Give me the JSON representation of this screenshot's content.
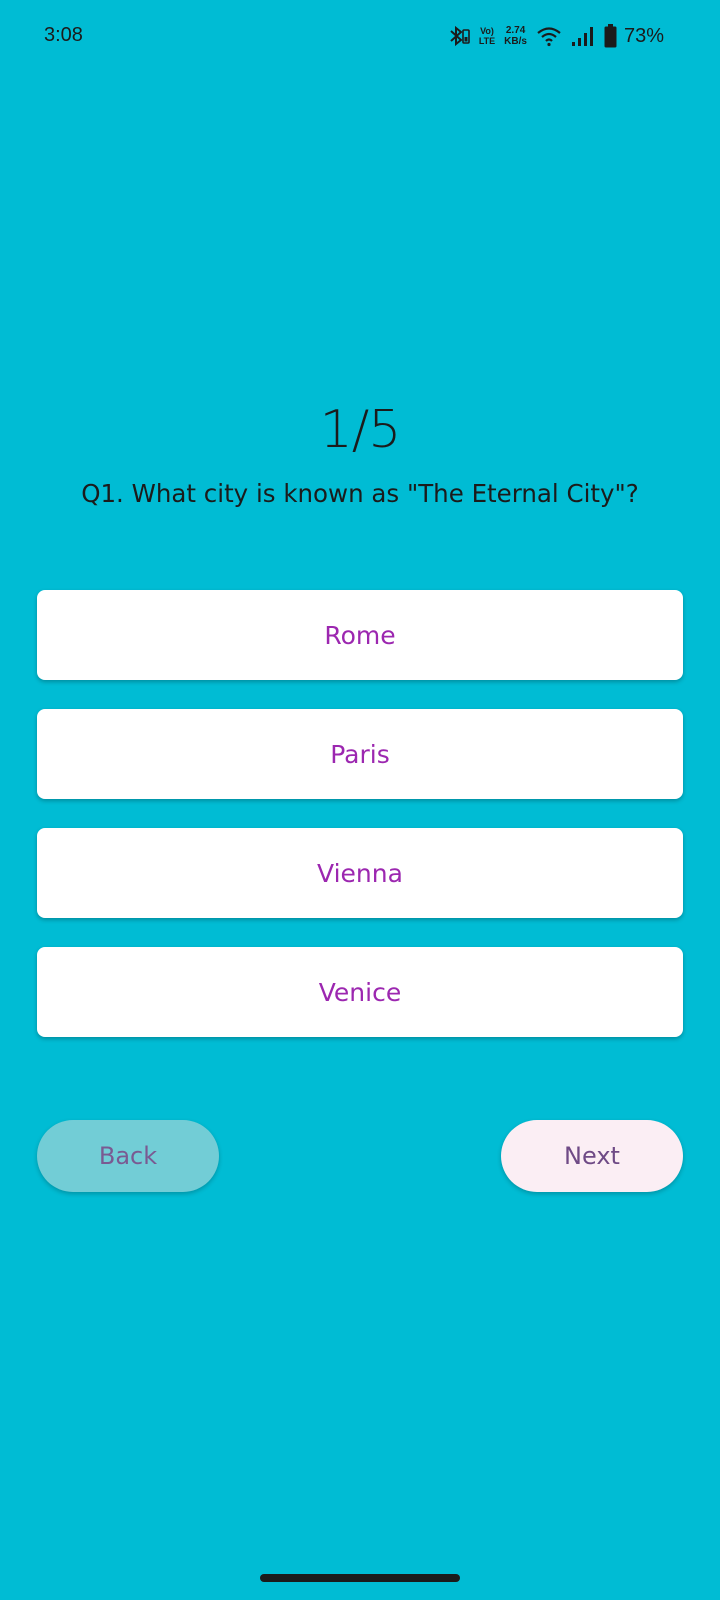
{
  "status_bar": {
    "time": "3:08",
    "volte_top": "Vo)",
    "volte_bottom": "LTE",
    "speed_value": "2.74",
    "speed_unit": "KB/s",
    "battery_percent": "73%",
    "icons": [
      "bluetooth-icon",
      "volte-icon",
      "wifi-icon",
      "signal-icon",
      "battery-icon"
    ]
  },
  "quiz": {
    "progress": "1/5",
    "question": "Q1. What city is known as \"The Eternal City\"?",
    "options": [
      "Rome",
      "Paris",
      "Vienna",
      "Venice"
    ]
  },
  "navigation": {
    "back_label": "Back",
    "next_label": "Next"
  },
  "colors": {
    "background": "#00BCD4",
    "option_text": "#9C27B0",
    "back_button": "#72CDD6",
    "next_button": "#FBEEF4"
  }
}
